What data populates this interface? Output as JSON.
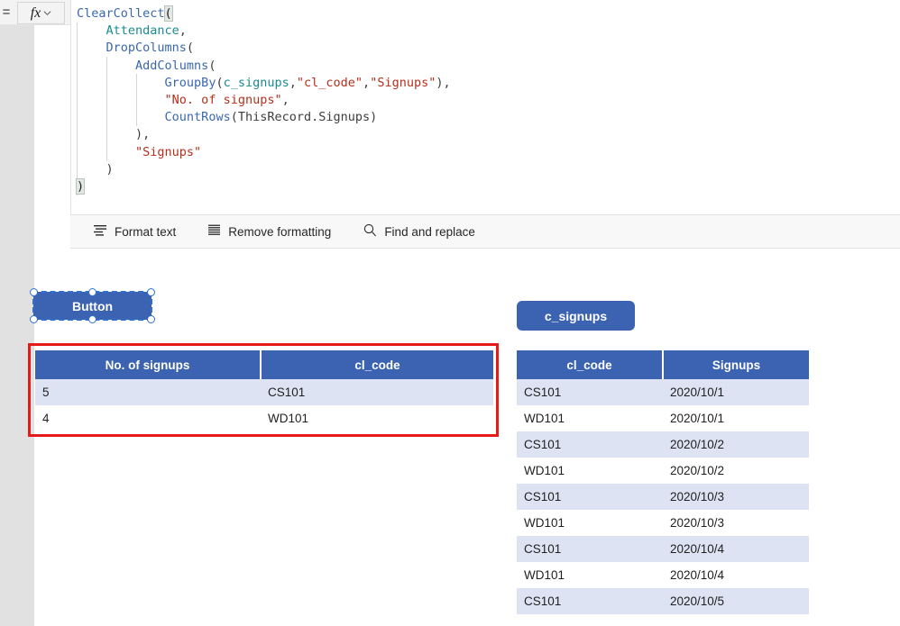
{
  "formula_bar": {
    "equals_label": "=",
    "fx_label": "fx",
    "chevron_icon": "chevron-down-icon"
  },
  "formula": {
    "lines": [
      [
        {
          "t": "ClearCollect",
          "c": "fn"
        },
        {
          "t": "(",
          "c": "paren-hl"
        }
      ],
      [
        {
          "t": "    ",
          "c": "punc"
        },
        {
          "t": "Attendance",
          "c": "ident"
        },
        {
          "t": ",",
          "c": "punc"
        }
      ],
      [
        {
          "t": "    ",
          "c": "punc"
        },
        {
          "t": "DropColumns",
          "c": "fn"
        },
        {
          "t": "(",
          "c": "punc"
        }
      ],
      [
        {
          "t": "        ",
          "c": "punc"
        },
        {
          "t": "AddColumns",
          "c": "fn"
        },
        {
          "t": "(",
          "c": "punc"
        }
      ],
      [
        {
          "t": "            ",
          "c": "punc"
        },
        {
          "t": "GroupBy",
          "c": "fn"
        },
        {
          "t": "(",
          "c": "punc"
        },
        {
          "t": "c_signups",
          "c": "ident"
        },
        {
          "t": ",",
          "c": "punc"
        },
        {
          "t": "\"cl_code\"",
          "c": "str"
        },
        {
          "t": ",",
          "c": "punc"
        },
        {
          "t": "\"Signups\"",
          "c": "str"
        },
        {
          "t": "),",
          "c": "punc"
        }
      ],
      [
        {
          "t": "            ",
          "c": "punc"
        },
        {
          "t": "\"No. of signups\"",
          "c": "str"
        },
        {
          "t": ",",
          "c": "punc"
        }
      ],
      [
        {
          "t": "            ",
          "c": "punc"
        },
        {
          "t": "CountRows",
          "c": "fn"
        },
        {
          "t": "(ThisRecord.Signups)",
          "c": "punc"
        }
      ],
      [
        {
          "t": "        ),",
          "c": "punc"
        }
      ],
      [
        {
          "t": "        ",
          "c": "punc"
        },
        {
          "t": "\"Signups\"",
          "c": "str"
        }
      ],
      [
        {
          "t": "    )",
          "c": "punc"
        }
      ],
      [
        {
          "t": ")",
          "c": "paren-hl"
        }
      ]
    ]
  },
  "editor_toolbar": {
    "items": [
      {
        "label": "Format text",
        "icon": "format-text-icon"
      },
      {
        "label": "Remove formatting",
        "icon": "remove-formatting-icon"
      },
      {
        "label": "Find and replace",
        "icon": "search-icon"
      }
    ]
  },
  "canvas": {
    "button_control": {
      "label": "Button",
      "selected": true,
      "accent_color": "#3b63b2"
    },
    "csignups_button": {
      "label": "c_signups",
      "accent_color": "#3b63b2"
    },
    "highlight_color": "#e81919"
  },
  "table_left": {
    "name": "Attendance",
    "headers": [
      "No. of signups",
      "cl_code"
    ],
    "rows": [
      [
        "5",
        "CS101"
      ],
      [
        "4",
        "WD101"
      ]
    ]
  },
  "table_right": {
    "name": "c_signups",
    "headers": [
      "cl_code",
      "Signups"
    ],
    "rows": [
      [
        "CS101",
        "2020/10/1"
      ],
      [
        "WD101",
        "2020/10/1"
      ],
      [
        "CS101",
        "2020/10/2"
      ],
      [
        "WD101",
        "2020/10/2"
      ],
      [
        "CS101",
        "2020/10/3"
      ],
      [
        "WD101",
        "2020/10/3"
      ],
      [
        "CS101",
        "2020/10/4"
      ],
      [
        "WD101",
        "2020/10/4"
      ],
      [
        "CS101",
        "2020/10/5"
      ]
    ]
  }
}
